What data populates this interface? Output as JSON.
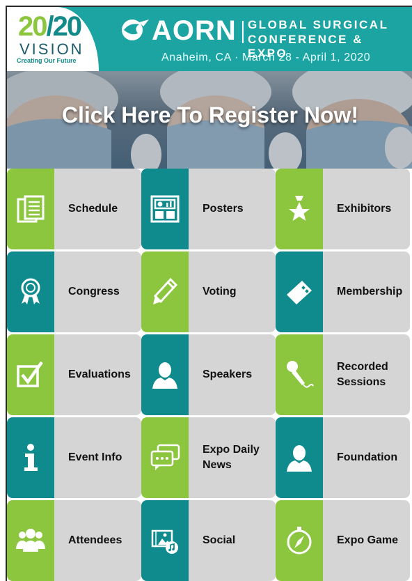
{
  "header": {
    "logo_big_a": "20",
    "logo_big_b": "/20",
    "logo_vision": "VISION",
    "logo_tagline": "Creating Our Future",
    "aorn": "AORN",
    "conf_line1": "GLOBAL SURGICAL",
    "conf_line2": "CONFERENCE & EXPO",
    "location": "Anaheim, CA · March 28 - April 1, 2020"
  },
  "banner": {
    "text": "Click Here To Register Now!"
  },
  "colors": {
    "teal": "#0f8b8d",
    "green": "#8cc63f",
    "header": "#1ba4a2",
    "tile_bg": "#d5d5d5"
  },
  "tiles": [
    {
      "label": "Schedule",
      "icon": "schedule-icon",
      "color": "green"
    },
    {
      "label": "Posters",
      "icon": "posters-icon",
      "color": "teal"
    },
    {
      "label": "Exhibitors",
      "icon": "exhibitors-icon",
      "color": "green"
    },
    {
      "label": "Congress",
      "icon": "award-ribbon-icon",
      "color": "teal"
    },
    {
      "label": "Voting",
      "icon": "pencil-icon",
      "color": "green"
    },
    {
      "label": "Membership",
      "icon": "ticket-icon",
      "color": "teal"
    },
    {
      "label": "Evaluations",
      "icon": "checkbox-icon",
      "color": "green"
    },
    {
      "label": "Speakers",
      "icon": "speaker-person-icon",
      "color": "teal"
    },
    {
      "label": "Recorded Sessions",
      "icon": "microphone-icon",
      "color": "green"
    },
    {
      "label": "Event Info",
      "icon": "info-icon",
      "color": "teal"
    },
    {
      "label": "Expo Daily News",
      "icon": "chat-bubbles-icon",
      "color": "green"
    },
    {
      "label": "Foundation",
      "icon": "foundation-person-icon",
      "color": "teal"
    },
    {
      "label": "Attendees",
      "icon": "people-group-icon",
      "color": "green"
    },
    {
      "label": "Social",
      "icon": "media-icon",
      "color": "teal"
    },
    {
      "label": "Expo Game",
      "icon": "compass-icon",
      "color": "green"
    }
  ]
}
